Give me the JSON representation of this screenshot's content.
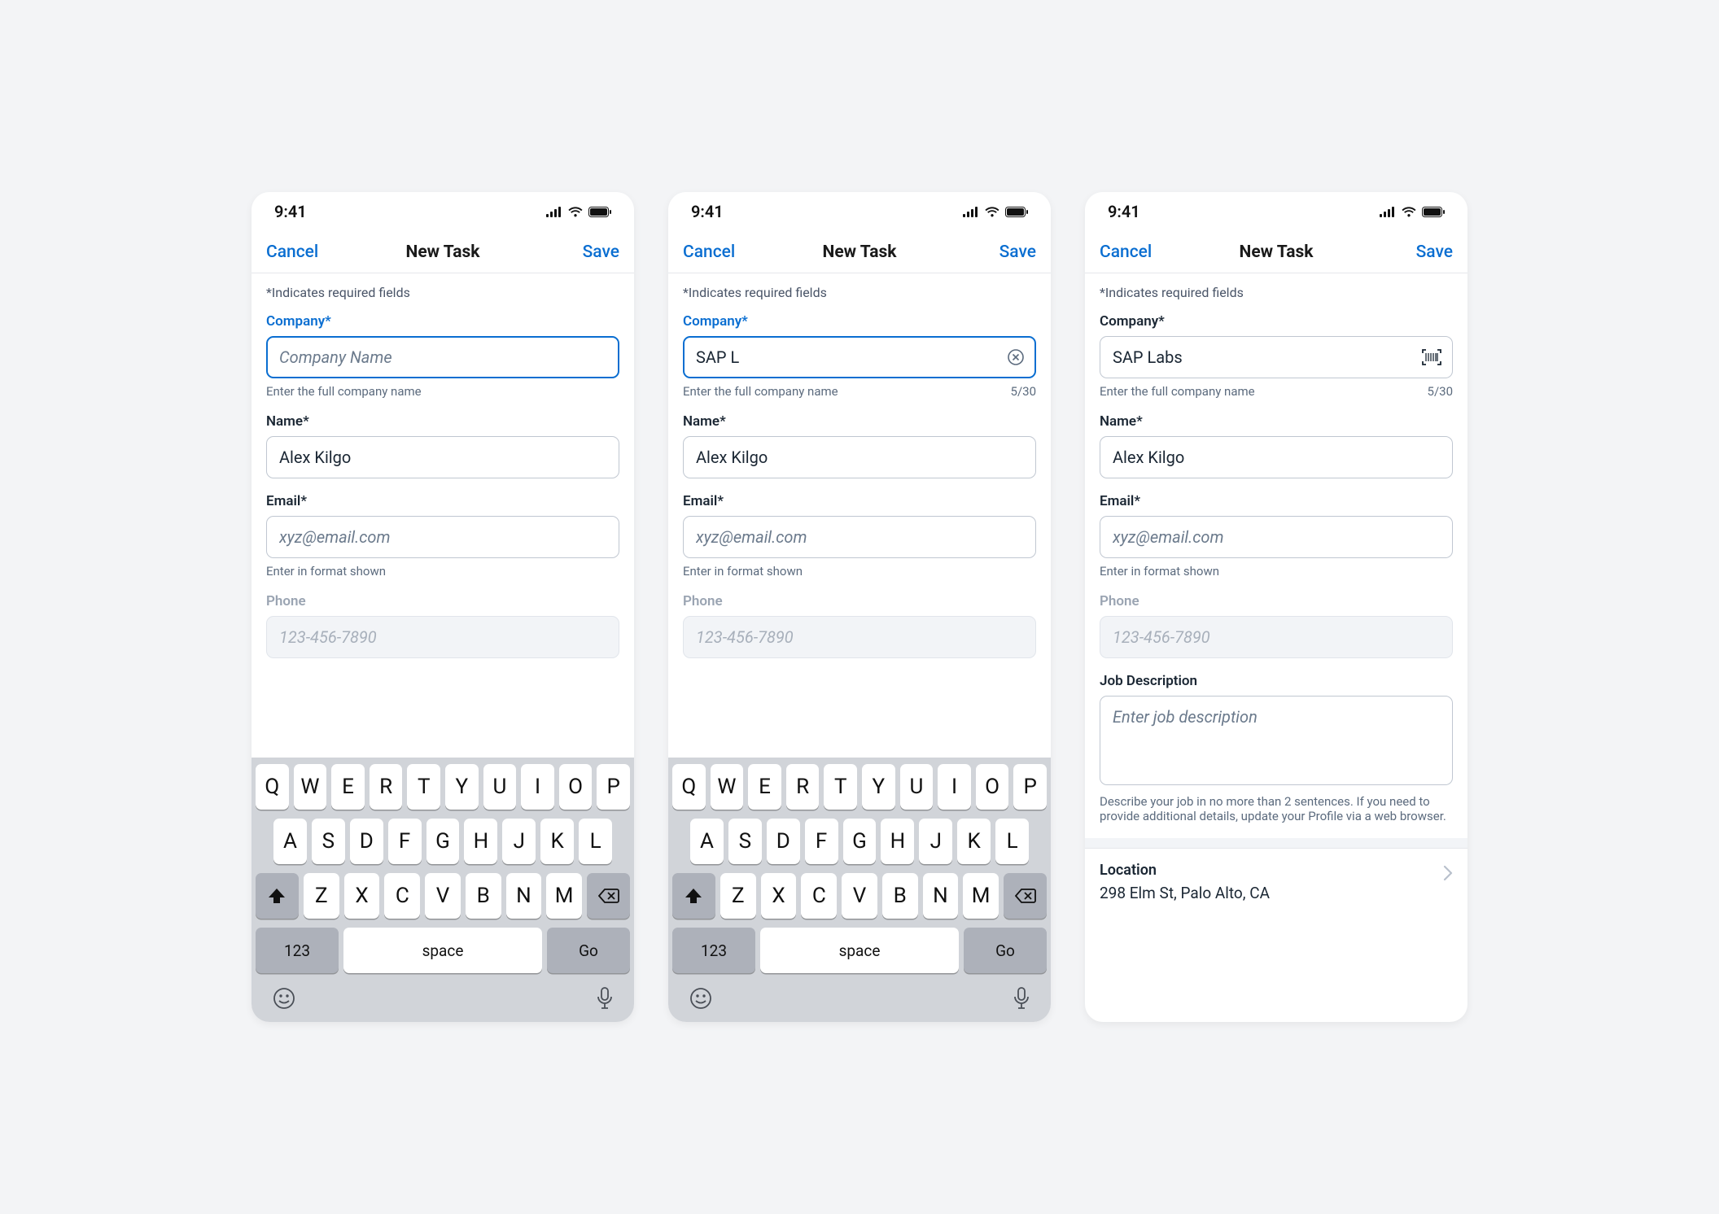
{
  "statusbar": {
    "time": "9:41"
  },
  "navbar": {
    "cancel": "Cancel",
    "title": "New Task",
    "save": "Save"
  },
  "required_note": "*Indicates required fields",
  "fields": {
    "company": {
      "label": "Company*",
      "placeholder": "Company Name",
      "helper": "Enter the full company name"
    },
    "name": {
      "label": "Name*",
      "value": "Alex Kilgo"
    },
    "email": {
      "label": "Email*",
      "placeholder": "xyz@email.com",
      "helper": "Enter in format shown"
    },
    "phone": {
      "label": "Phone",
      "placeholder": "123-456-7890"
    },
    "job_description": {
      "label": "Job Description",
      "placeholder": "Enter job description",
      "helper": "Describe your job in no more than 2 sentences. If you need to provide additional details, update your Profile via a web browser."
    }
  },
  "screen2": {
    "company_value": "SAP L",
    "counter": "5/30"
  },
  "screen3": {
    "company_value": "SAP Labs",
    "counter": "5/30"
  },
  "location": {
    "label": "Location",
    "value": "298 Elm St, Palo Alto, CA"
  },
  "keyboard": {
    "row1": [
      "Q",
      "W",
      "E",
      "R",
      "T",
      "Y",
      "U",
      "I",
      "O",
      "P"
    ],
    "row2": [
      "A",
      "S",
      "D",
      "F",
      "G",
      "H",
      "J",
      "K",
      "L"
    ],
    "row3": [
      "Z",
      "X",
      "C",
      "V",
      "B",
      "N",
      "M"
    ],
    "num": "123",
    "space": "space",
    "go": "Go"
  }
}
